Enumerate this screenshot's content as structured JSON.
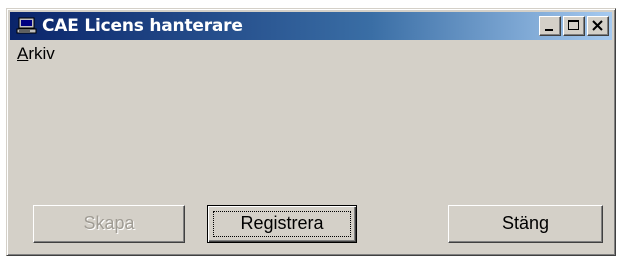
{
  "window": {
    "title": "CAE Licens hanterare",
    "icon": "computer-icon"
  },
  "caption_buttons": {
    "minimize_icon": "minimize-icon",
    "maximize_icon": "maximize-icon",
    "close_icon": "close-icon"
  },
  "menu": {
    "items": [
      {
        "accelerator": "A",
        "rest": "rkiv"
      }
    ]
  },
  "buttons": {
    "skapa": {
      "label": "Skapa",
      "enabled": false
    },
    "registrera": {
      "label": "Registrera",
      "enabled": true,
      "focused": true
    },
    "stang": {
      "label": "Stäng",
      "enabled": true
    }
  },
  "colors": {
    "title_gradient_start": "#0a246a",
    "title_gradient_end": "#a6caf0",
    "face": "#d4d0c8"
  }
}
